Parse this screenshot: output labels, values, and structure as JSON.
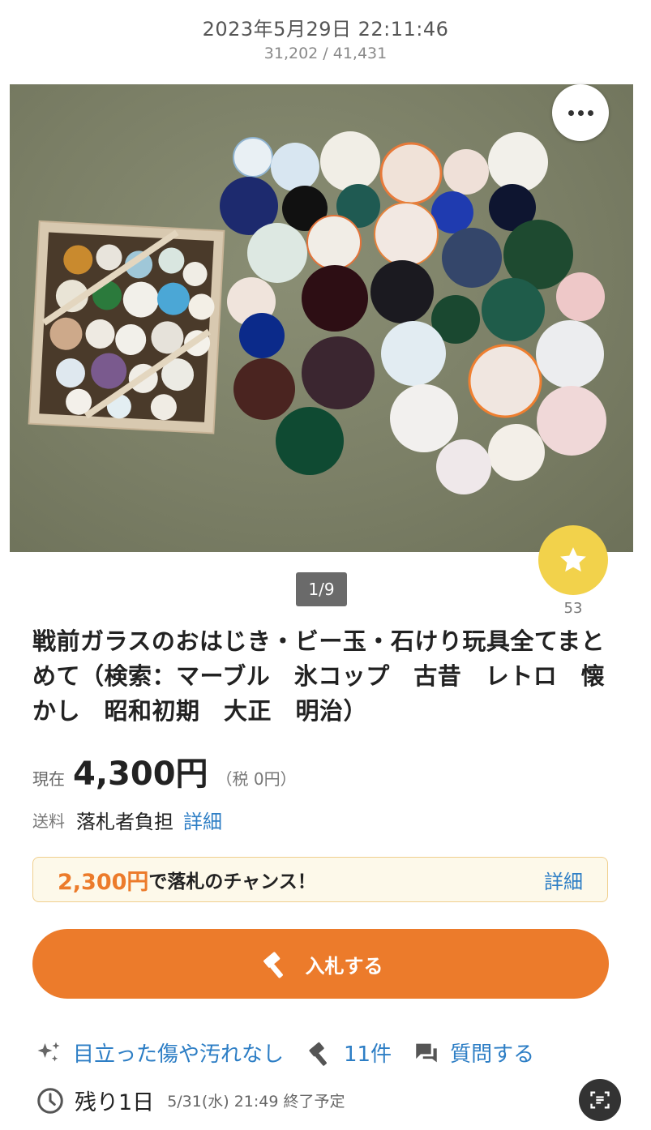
{
  "header": {
    "datetime": "2023年5月29日 22:11:46",
    "counter": "31,202 / 41,431"
  },
  "gallery": {
    "page_indicator": "1/9",
    "watch_count": "53",
    "more_icon": "more-horizontal-icon",
    "favorite_icon": "star-icon"
  },
  "item": {
    "title": "戦前ガラスのおはじき・ビー玉・石けり玩具全てまとめて（検索：マーブル　氷コップ　古昔　レトロ　懐かし　昭和初期　大正　明治）",
    "price_label": "現在",
    "price": "4,300円",
    "tax": "（税 0円）",
    "shipping_label": "送料",
    "shipping_value": "落札者負担",
    "shipping_detail": "詳細"
  },
  "chance": {
    "price": "2,300円",
    "text": "で落札のチャンス！",
    "detail": "詳細"
  },
  "bid_button": {
    "label": "入札する",
    "icon": "gavel-icon"
  },
  "info": {
    "condition": "目立った傷や汚れなし",
    "bids": "11件",
    "question": "質問する"
  },
  "ending": {
    "remaining": "残り1日",
    "end_datetime": "5/31(水) 21:49 終了予定"
  },
  "colors": {
    "accent": "#ec7b2b",
    "link": "#2d7ec5",
    "star": "#f2d24b"
  }
}
